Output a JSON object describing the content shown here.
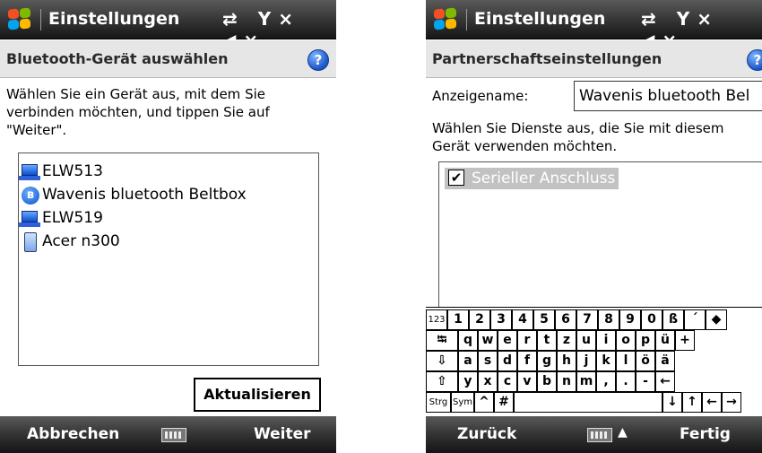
{
  "left": {
    "title": "Einstellungen",
    "status_icons": "⇄ Y× ◀×",
    "header": "Bluetooth-Gerät auswählen",
    "help": "?",
    "instructions": [
      "Wählen Sie ein Gerät aus, mit dem Sie",
      "verbinden möchten, und tippen Sie auf",
      "\"Weiter\"."
    ],
    "devices": [
      {
        "label": "ELW513",
        "icon": "computer-icon"
      },
      {
        "label": "Wavenis bluetooth Beltbox",
        "icon": "bluetooth-icon"
      },
      {
        "label": "ELW519",
        "icon": "computer-icon"
      },
      {
        "label": "Acer n300",
        "icon": "pda-icon"
      }
    ],
    "refresh_button": "Aktualisieren",
    "softkey_left": "Abbrechen",
    "softkey_right": "Weiter"
  },
  "right": {
    "title": "Einstellungen",
    "status_icons": "⇄ Y× ◀×",
    "header": "Partnerschaftseinstellungen",
    "help": "?",
    "display_name_label": "Anzeigename:",
    "display_name_value": "Wavenis bluetooth Bel",
    "instructions": [
      "Wählen Sie Dienste aus, die Sie mit diesem",
      "Gerät verwenden möchten."
    ],
    "services": [
      {
        "label": "Serieller Anschluss",
        "checked": true
      }
    ],
    "softkey_left": "Zurück",
    "softkey_right": "Fertig",
    "keyboard_arrow": "▲",
    "keyboard": {
      "row1": [
        "123",
        "1",
        "2",
        "3",
        "4",
        "5",
        "6",
        "7",
        "8",
        "9",
        "0",
        "ß",
        "´",
        "◆"
      ],
      "row2": [
        "⭾",
        "q",
        "w",
        "e",
        "r",
        "t",
        "z",
        "u",
        "i",
        "o",
        "p",
        "ü",
        "+"
      ],
      "row3": [
        "⇩",
        "a",
        "s",
        "d",
        "f",
        "g",
        "h",
        "j",
        "k",
        "l",
        "ö",
        "ä"
      ],
      "row4": [
        "⇧",
        "y",
        "x",
        "c",
        "v",
        "b",
        "n",
        "m",
        ",",
        ".",
        "-",
        "←"
      ],
      "row5": [
        "Strg",
        "Sym",
        "^",
        "#",
        "",
        "↓",
        "↑",
        "←",
        "→"
      ]
    }
  }
}
